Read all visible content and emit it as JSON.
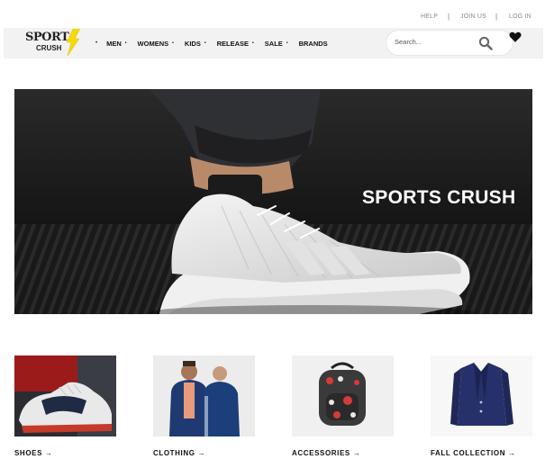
{
  "utility_links": [
    {
      "label": "HELP"
    },
    {
      "label": "JOIN US"
    },
    {
      "label": "LOG IN"
    }
  ],
  "utility_separator": "|",
  "logo": {
    "line1": "SPORT",
    "line2": "CRUSH"
  },
  "nav": {
    "bullet": "•",
    "items": [
      {
        "label": "MEN",
        "has_dropdown": true
      },
      {
        "label": "WOMENS",
        "has_dropdown": true
      },
      {
        "label": "KIDS",
        "has_dropdown": true
      },
      {
        "label": "RELEASE",
        "has_dropdown": true
      },
      {
        "label": "SALE",
        "has_dropdown": true
      },
      {
        "label": "BRANDS",
        "has_dropdown": false
      }
    ]
  },
  "search": {
    "placeholder": "Search...",
    "icon": "search-icon"
  },
  "wishlist": {
    "icon": "heart-icon"
  },
  "hero": {
    "title": "SPORTS CRUSH"
  },
  "categories": [
    {
      "label": "SHOES",
      "arrow": "→"
    },
    {
      "label": "CLOTHING",
      "arrow": "→"
    },
    {
      "label": "ACCESSORIES",
      "arrow": "→"
    },
    {
      "label": "FALL COLLECTION",
      "arrow": "→"
    }
  ],
  "colors": {
    "accent_yellow": "#f5d90a",
    "nav_bg": "#f2f2f2",
    "text": "#111111"
  }
}
